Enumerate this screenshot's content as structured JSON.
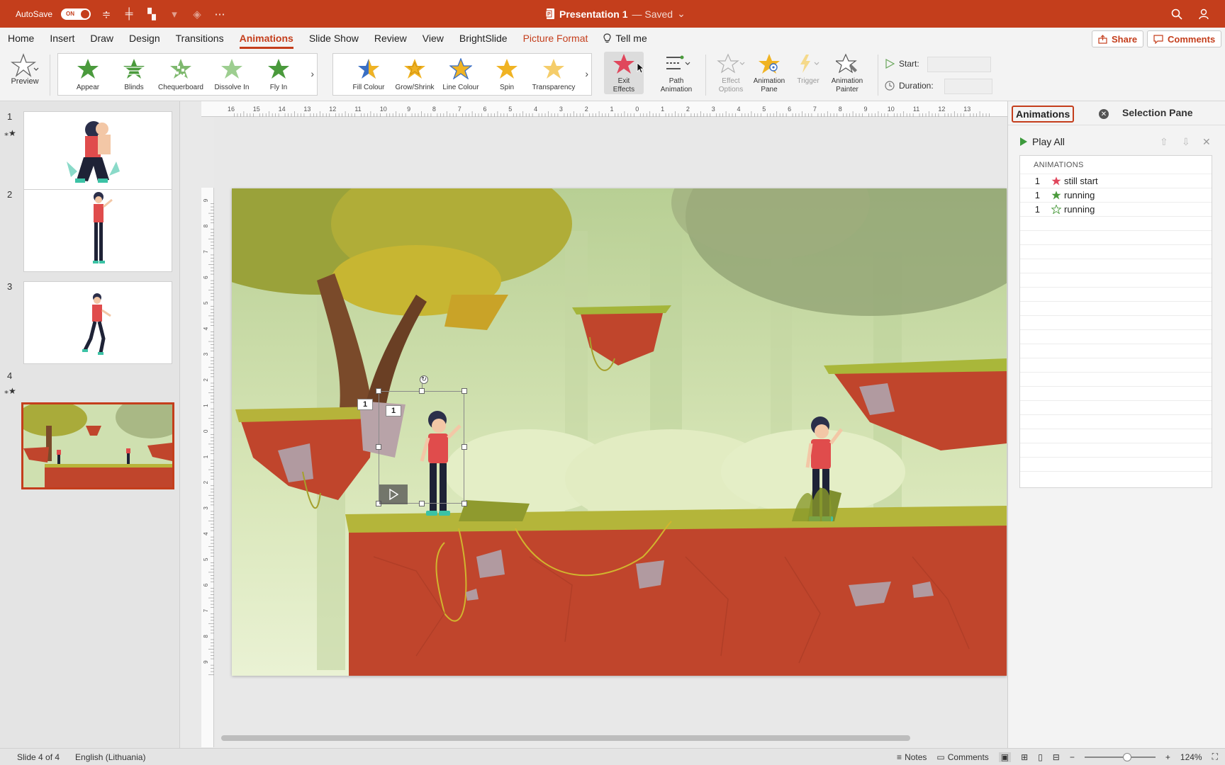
{
  "titlebar": {
    "autosave_label": "AutoSave",
    "autosave_state": "ON",
    "doc_name": "Presentation 1",
    "saved_state": "— Saved"
  },
  "menu": {
    "tabs": [
      "Home",
      "Insert",
      "Draw",
      "Design",
      "Transitions",
      "Animations",
      "Slide Show",
      "Review",
      "View",
      "BrightSlide",
      "Picture Format"
    ],
    "active": "Animations",
    "tell_me": "Tell me",
    "share": "Share",
    "comments": "Comments"
  },
  "ribbon": {
    "preview": "Preview",
    "entrance_effects": [
      "Appear",
      "Blinds",
      "Chequerboard",
      "Dissolve In",
      "Fly In"
    ],
    "emphasis_effects": [
      "Fill Colour",
      "Grow/Shrink",
      "Line Colour",
      "Spin",
      "Transparency"
    ],
    "exit_effects": [
      "Exit",
      "Effects"
    ],
    "path_animation": [
      "Path",
      "Animation"
    ],
    "effect_options": [
      "Effect",
      "Options"
    ],
    "animation_pane": [
      "Animation",
      "Pane"
    ],
    "trigger": "Trigger",
    "animation_painter": [
      "Animation",
      "Painter"
    ],
    "start_label": "Start:",
    "duration_label": "Duration:"
  },
  "slides": {
    "numbers": [
      "1",
      "2",
      "3",
      "4"
    ],
    "selected": "4"
  },
  "ruler": {
    "h_ticks": [
      "16",
      "15",
      "14",
      "13",
      "12",
      "11",
      "10",
      "9",
      "8",
      "7",
      "6",
      "5",
      "4",
      "3",
      "2",
      "1",
      "0",
      "1",
      "2",
      "3",
      "4",
      "5",
      "6",
      "7",
      "8",
      "9",
      "10",
      "11",
      "12",
      "13"
    ],
    "v_ticks": [
      "9",
      "8",
      "7",
      "6",
      "5",
      "4",
      "3",
      "2",
      "1",
      "0",
      "1",
      "2",
      "3",
      "4",
      "5",
      "6",
      "7",
      "8",
      "9"
    ]
  },
  "slide": {
    "tag_a": "1",
    "tag_b": "1"
  },
  "pane": {
    "tab_active": "Animations",
    "tab_other": "Selection Pane",
    "play_all": "Play All",
    "list_header": "ANIMATIONS",
    "items": [
      {
        "order": "1",
        "name": "still start",
        "kind": "exit"
      },
      {
        "order": "1",
        "name": "running",
        "kind": "entrance"
      },
      {
        "order": "1",
        "name": "running",
        "kind": "entrance-dim"
      }
    ]
  },
  "status": {
    "slide_of": "Slide 4 of 4",
    "language": "English (Lithuania)",
    "notes": "Notes",
    "comments": "Comments",
    "zoom": "124%"
  },
  "colors": {
    "accent": "#c43e1c",
    "entrance_star": "#4a9a3c",
    "emphasis_star": "#f0b323",
    "exit_star": "#e0475c"
  }
}
